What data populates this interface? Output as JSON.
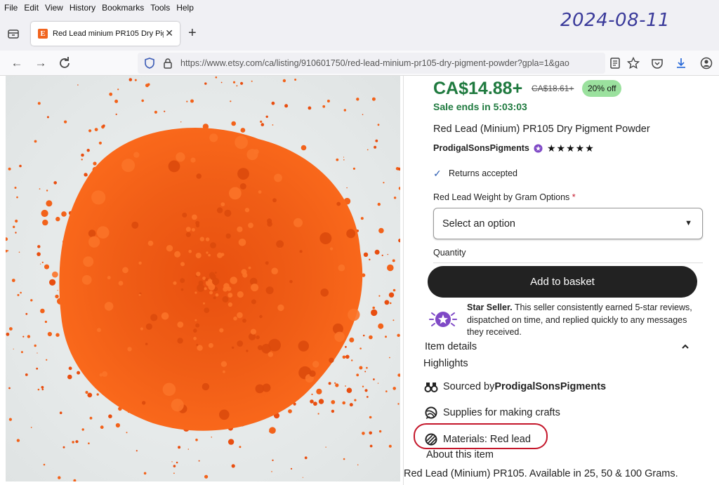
{
  "menubar": {
    "items": [
      "File",
      "Edit",
      "View",
      "History",
      "Bookmarks",
      "Tools",
      "Help"
    ]
  },
  "date_stamp": "2024-08-11",
  "tab": {
    "favicon_letter": "E",
    "title": "Red Lead minium PR105 Dry Pig"
  },
  "navbar": {
    "url": "https://www.etsy.com/ca/listing/910601750/red-lead-minium-pr105-dry-pigment-powder?gpla=1&gao"
  },
  "listing": {
    "price": "CA$14.88+",
    "original_price": "CA$18.61+",
    "discount": "20% off",
    "sale_text": "Sale ends in 5:03:03",
    "title": "Red Lead (Minium) PR105 Dry Pigment Powder",
    "shop_name": "ProdigalSonsPigments",
    "rating_stars": "★★★★★",
    "returns": "Returns accepted",
    "variation_label": "Red Lead Weight by Gram Options",
    "required_mark": "*",
    "select_placeholder": "Select an option",
    "quantity_label": "Quantity",
    "add_button": "Add to basket",
    "star_seller_title": "Star Seller.",
    "star_seller_text": " This seller consistently earned 5-star reviews, dispatched on time, and replied quickly to any messages they received.",
    "item_details": "Item details",
    "highlights": "Highlights",
    "sourced_prefix": "Sourced by ",
    "sourced_by": "ProdigalSonsPigments",
    "supplies": "Supplies for making crafts",
    "materials": "Materials: Red lead",
    "about": "About this item",
    "description": "Red Lead (Minium) PR105. Available in 25, 50 & 100  Grams."
  },
  "colors": {
    "price_green": "#1f7a3f",
    "discount_bg": "#9be19e",
    "button_bg": "#222222",
    "annotation_red": "#c4162a",
    "star_seller_purple": "#7f49c6",
    "pigment_orange": "#f15a12"
  }
}
